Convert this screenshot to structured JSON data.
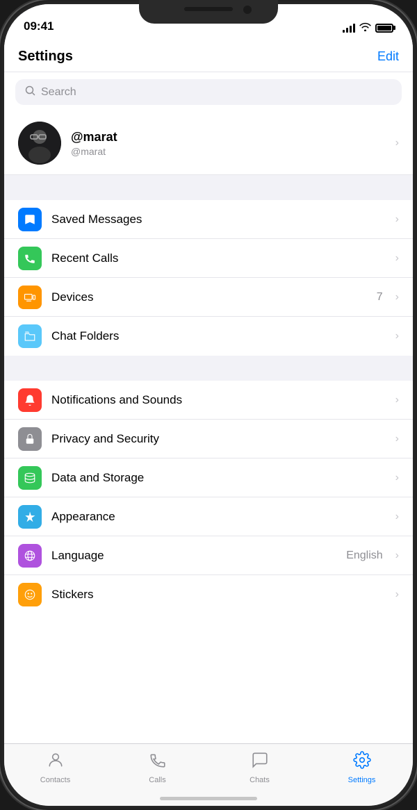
{
  "statusBar": {
    "time": "09:41"
  },
  "header": {
    "title": "Settings",
    "editLabel": "Edit"
  },
  "search": {
    "placeholder": "Search"
  },
  "profile": {
    "name": "@marat",
    "handle": "@marat"
  },
  "section1": [
    {
      "id": "saved-messages",
      "label": "Saved Messages",
      "iconColor": "icon-blue",
      "iconSymbol": "🔖",
      "badge": "",
      "value": ""
    },
    {
      "id": "recent-calls",
      "label": "Recent Calls",
      "iconColor": "icon-green",
      "iconSymbol": "📞",
      "badge": "",
      "value": ""
    },
    {
      "id": "devices",
      "label": "Devices",
      "iconColor": "icon-orange",
      "iconSymbol": "🖥",
      "badge": "7",
      "value": ""
    },
    {
      "id": "chat-folders",
      "label": "Chat Folders",
      "iconColor": "icon-teal",
      "iconSymbol": "🗂",
      "badge": "",
      "value": ""
    }
  ],
  "section2": [
    {
      "id": "notifications",
      "label": "Notifications and Sounds",
      "iconColor": "icon-red",
      "iconSymbol": "🔔",
      "badge": "",
      "value": ""
    },
    {
      "id": "privacy",
      "label": "Privacy and Security",
      "iconColor": "icon-gray",
      "iconSymbol": "🔒",
      "badge": "",
      "value": ""
    },
    {
      "id": "data",
      "label": "Data and Storage",
      "iconColor": "icon-green2",
      "iconSymbol": "📊",
      "badge": "",
      "value": ""
    },
    {
      "id": "appearance",
      "label": "Appearance",
      "iconColor": "icon-cyan",
      "iconSymbol": "🎨",
      "badge": "",
      "value": ""
    },
    {
      "id": "language",
      "label": "Language",
      "iconColor": "icon-purple",
      "iconSymbol": "🌐",
      "badge": "",
      "value": "English"
    },
    {
      "id": "stickers",
      "label": "Stickers",
      "iconColor": "icon-amber",
      "iconSymbol": "😊",
      "badge": "",
      "value": ""
    }
  ],
  "tabs": [
    {
      "id": "contacts",
      "label": "Contacts",
      "symbol": "👤",
      "active": false
    },
    {
      "id": "calls",
      "label": "Calls",
      "symbol": "📞",
      "active": false
    },
    {
      "id": "chats",
      "label": "Chats",
      "symbol": "💬",
      "active": false
    },
    {
      "id": "settings",
      "label": "Settings",
      "symbol": "⚙️",
      "active": true
    }
  ]
}
